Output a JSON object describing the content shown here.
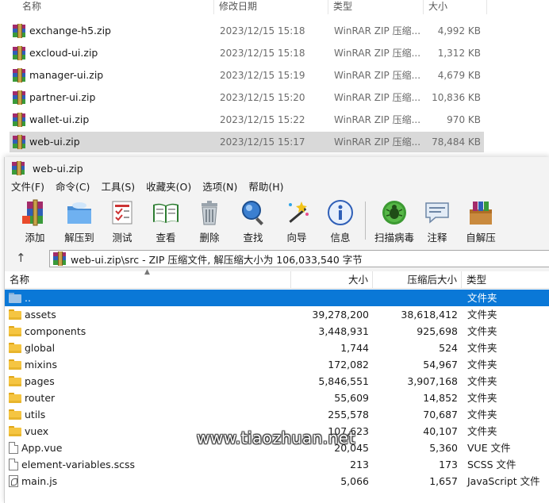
{
  "explorer": {
    "columns": {
      "name": "名称",
      "date": "修改日期",
      "type": "类型",
      "size": "大小"
    },
    "files": [
      {
        "name": "exchange-h5.zip",
        "date": "2023/12/15 15:18",
        "type": "WinRAR ZIP 压缩...",
        "size": "4,992 KB"
      },
      {
        "name": "excloud-ui.zip",
        "date": "2023/12/15 15:18",
        "type": "WinRAR ZIP 压缩...",
        "size": "1,312 KB"
      },
      {
        "name": "manager-ui.zip",
        "date": "2023/12/15 15:19",
        "type": "WinRAR ZIP 压缩...",
        "size": "4,679 KB"
      },
      {
        "name": "partner-ui.zip",
        "date": "2023/12/15 15:20",
        "type": "WinRAR ZIP 压缩...",
        "size": "10,836 KB"
      },
      {
        "name": "wallet-ui.zip",
        "date": "2023/12/15 15:22",
        "type": "WinRAR ZIP 压缩...",
        "size": "970 KB"
      },
      {
        "name": "web-ui.zip",
        "date": "2023/12/15 15:17",
        "type": "WinRAR ZIP 压缩...",
        "size": "78,484 KB"
      }
    ]
  },
  "winrar": {
    "title": "web-ui.zip",
    "menu": [
      "文件(F)",
      "命令(C)",
      "工具(S)",
      "收藏夹(O)",
      "选项(N)",
      "帮助(H)"
    ],
    "toolbar": [
      {
        "label": "添加",
        "icon": "add-archive-icon"
      },
      {
        "label": "解压到",
        "icon": "extract-to-icon"
      },
      {
        "label": "测试",
        "icon": "test-icon"
      },
      {
        "label": "查看",
        "icon": "view-icon"
      },
      {
        "label": "删除",
        "icon": "delete-icon"
      },
      {
        "label": "查找",
        "icon": "find-icon"
      },
      {
        "label": "向导",
        "icon": "wizard-icon"
      },
      {
        "label": "信息",
        "icon": "info-icon"
      },
      {
        "label": "扫描病毒",
        "icon": "virus-scan-icon"
      },
      {
        "label": "注释",
        "icon": "comment-icon"
      },
      {
        "label": "自解压",
        "icon": "sfx-icon"
      }
    ],
    "address": "web-ui.zip\\src - ZIP 压缩文件, 解压缩大小为 106,033,540 字节",
    "columns": {
      "name": "名称",
      "size": "大小",
      "packed": "压缩后大小",
      "type": "类型"
    },
    "rows": [
      {
        "name": "..",
        "size": "",
        "packed": "",
        "type": "文件夹",
        "icon": "parent-folder-icon"
      },
      {
        "name": "assets",
        "size": "39,278,200",
        "packed": "38,618,412",
        "type": "文件夹",
        "icon": "folder-icon"
      },
      {
        "name": "components",
        "size": "3,448,931",
        "packed": "925,698",
        "type": "文件夹",
        "icon": "folder-icon"
      },
      {
        "name": "global",
        "size": "1,744",
        "packed": "524",
        "type": "文件夹",
        "icon": "folder-icon"
      },
      {
        "name": "mixins",
        "size": "172,082",
        "packed": "54,967",
        "type": "文件夹",
        "icon": "folder-icon"
      },
      {
        "name": "pages",
        "size": "5,846,551",
        "packed": "3,907,168",
        "type": "文件夹",
        "icon": "folder-icon"
      },
      {
        "name": "router",
        "size": "55,609",
        "packed": "14,852",
        "type": "文件夹",
        "icon": "folder-icon"
      },
      {
        "name": "utils",
        "size": "255,578",
        "packed": "70,687",
        "type": "文件夹",
        "icon": "folder-icon"
      },
      {
        "name": "vuex",
        "size": "107,623",
        "packed": "40,107",
        "type": "文件夹",
        "icon": "folder-icon"
      },
      {
        "name": "App.vue",
        "size": "20,045",
        "packed": "5,360",
        "type": "VUE 文件",
        "icon": "file-icon"
      },
      {
        "name": "element-variables.scss",
        "size": "213",
        "packed": "173",
        "type": "SCSS 文件",
        "icon": "file-icon"
      },
      {
        "name": "main.js",
        "size": "5,066",
        "packed": "1,657",
        "type": "JavaScript 文件",
        "icon": "js-file-icon"
      }
    ]
  },
  "watermark": "www.tiaozhuan.net",
  "colors": {
    "selection_blue": "#0a78d7",
    "explorer_selected": "#d9d9d9"
  }
}
